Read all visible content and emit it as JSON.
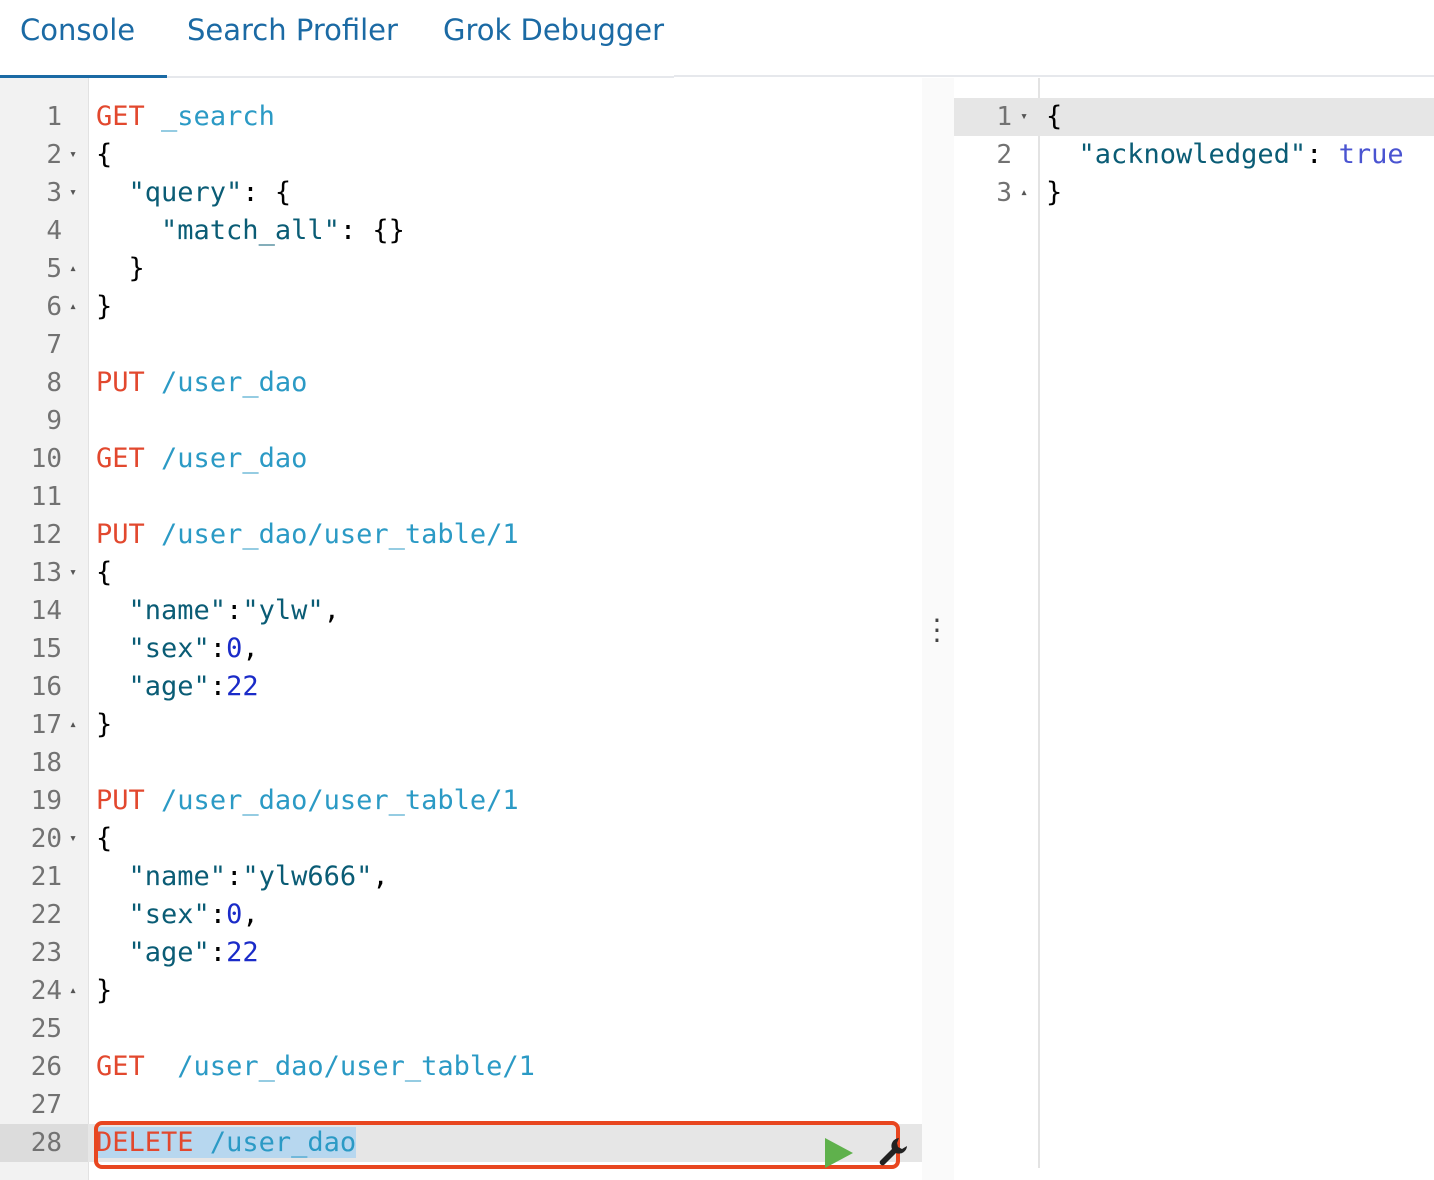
{
  "tabs": [
    {
      "label": "Console",
      "active": true
    },
    {
      "label": "Search Profiler",
      "active": false
    },
    {
      "label": "Grok Debugger",
      "active": false
    }
  ],
  "editor": {
    "lines": [
      {
        "n": "1",
        "fold": "",
        "parts": [
          [
            "method",
            "GET"
          ],
          [
            "punc",
            " "
          ],
          [
            "url",
            "_search"
          ]
        ]
      },
      {
        "n": "2",
        "fold": "▾",
        "parts": [
          [
            "punc",
            "{"
          ]
        ]
      },
      {
        "n": "3",
        "fold": "▾",
        "parts": [
          [
            "punc",
            "  "
          ],
          [
            "key",
            "\"query\""
          ],
          [
            "punc",
            ": {"
          ]
        ]
      },
      {
        "n": "4",
        "fold": "",
        "parts": [
          [
            "punc",
            "    "
          ],
          [
            "key",
            "\"match_all\""
          ],
          [
            "punc",
            ": {}"
          ]
        ]
      },
      {
        "n": "5",
        "fold": "▴",
        "parts": [
          [
            "punc",
            "  }"
          ]
        ]
      },
      {
        "n": "6",
        "fold": "▴",
        "parts": [
          [
            "punc",
            "}"
          ]
        ]
      },
      {
        "n": "7",
        "fold": "",
        "parts": []
      },
      {
        "n": "8",
        "fold": "",
        "parts": [
          [
            "method",
            "PUT"
          ],
          [
            "punc",
            " "
          ],
          [
            "url",
            "/user_dao"
          ]
        ]
      },
      {
        "n": "9",
        "fold": "",
        "parts": []
      },
      {
        "n": "10",
        "fold": "",
        "parts": [
          [
            "method",
            "GET"
          ],
          [
            "punc",
            " "
          ],
          [
            "url",
            "/user_dao"
          ]
        ]
      },
      {
        "n": "11",
        "fold": "",
        "parts": []
      },
      {
        "n": "12",
        "fold": "",
        "parts": [
          [
            "method",
            "PUT"
          ],
          [
            "punc",
            " "
          ],
          [
            "url",
            "/user_dao/user_table/1"
          ]
        ]
      },
      {
        "n": "13",
        "fold": "▾",
        "parts": [
          [
            "punc",
            "{"
          ]
        ]
      },
      {
        "n": "14",
        "fold": "",
        "parts": [
          [
            "punc",
            "  "
          ],
          [
            "key",
            "\"name\""
          ],
          [
            "punc",
            ":"
          ],
          [
            "str",
            "\"ylw\""
          ],
          [
            "punc",
            ","
          ]
        ]
      },
      {
        "n": "15",
        "fold": "",
        "parts": [
          [
            "punc",
            "  "
          ],
          [
            "key",
            "\"sex\""
          ],
          [
            "punc",
            ":"
          ],
          [
            "num",
            "0"
          ],
          [
            "punc",
            ","
          ]
        ]
      },
      {
        "n": "16",
        "fold": "",
        "parts": [
          [
            "punc",
            "  "
          ],
          [
            "key",
            "\"age\""
          ],
          [
            "punc",
            ":"
          ],
          [
            "num",
            "22"
          ]
        ]
      },
      {
        "n": "17",
        "fold": "▴",
        "parts": [
          [
            "punc",
            "}"
          ]
        ]
      },
      {
        "n": "18",
        "fold": "",
        "parts": []
      },
      {
        "n": "19",
        "fold": "",
        "parts": [
          [
            "method",
            "PUT"
          ],
          [
            "punc",
            " "
          ],
          [
            "url",
            "/user_dao/user_table/1"
          ]
        ]
      },
      {
        "n": "20",
        "fold": "▾",
        "parts": [
          [
            "punc",
            "{"
          ]
        ]
      },
      {
        "n": "21",
        "fold": "",
        "parts": [
          [
            "punc",
            "  "
          ],
          [
            "key",
            "\"name\""
          ],
          [
            "punc",
            ":"
          ],
          [
            "str",
            "\"ylw666\""
          ],
          [
            "punc",
            ","
          ]
        ]
      },
      {
        "n": "22",
        "fold": "",
        "parts": [
          [
            "punc",
            "  "
          ],
          [
            "key",
            "\"sex\""
          ],
          [
            "punc",
            ":"
          ],
          [
            "num",
            "0"
          ],
          [
            "punc",
            ","
          ]
        ]
      },
      {
        "n": "23",
        "fold": "",
        "parts": [
          [
            "punc",
            "  "
          ],
          [
            "key",
            "\"age\""
          ],
          [
            "punc",
            ":"
          ],
          [
            "num",
            "22"
          ]
        ]
      },
      {
        "n": "24",
        "fold": "▴",
        "parts": [
          [
            "punc",
            "}"
          ]
        ]
      },
      {
        "n": "25",
        "fold": "",
        "parts": []
      },
      {
        "n": "26",
        "fold": "",
        "parts": [
          [
            "method",
            "GET"
          ],
          [
            "punc",
            "  "
          ],
          [
            "url",
            "/user_dao/user_table/1"
          ]
        ]
      },
      {
        "n": "27",
        "fold": "",
        "parts": []
      },
      {
        "n": "28",
        "fold": "",
        "active": true,
        "parts": [
          [
            "method",
            "DELETE"
          ],
          [
            "punc",
            " "
          ],
          [
            "url",
            "/user_dao"
          ]
        ]
      }
    ]
  },
  "output": {
    "lines": [
      {
        "n": "1",
        "fold": "▾",
        "active": true,
        "parts": [
          [
            "punc",
            "{"
          ]
        ]
      },
      {
        "n": "2",
        "fold": "",
        "parts": [
          [
            "punc",
            "  "
          ],
          [
            "key",
            "\"acknowledged\""
          ],
          [
            "punc",
            ": "
          ],
          [
            "bool",
            "true"
          ]
        ]
      },
      {
        "n": "3",
        "fold": "▴",
        "parts": [
          [
            "punc",
            "}"
          ]
        ]
      }
    ]
  },
  "icons": {
    "send": "play-icon",
    "settings": "wrench-icon",
    "resize": "vertical-dots-icon"
  },
  "colors": {
    "tab_text": "#1b6aa4",
    "method": "#e2482e",
    "url": "#2b9ac5",
    "string": "#0a5c75",
    "number": "#1a2bc8",
    "boolean": "#4a54d1",
    "highlight_border": "#e8461f",
    "play": "#5fb14c"
  }
}
